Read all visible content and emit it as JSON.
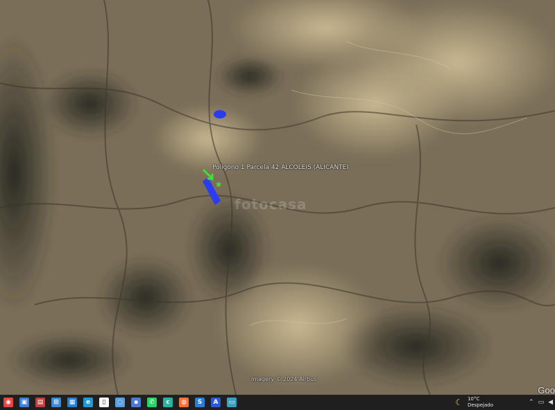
{
  "map": {
    "placemark_label": "Polígono 1 Parcela 42 ALCOLEIS (ALICANTE)",
    "watermark": "fotocasa",
    "imagery_credit": "Imagery © 2024 Airbus",
    "logo": "Goo"
  },
  "colors": {
    "parcel_fill": "#2b3cf0",
    "arrow": "#44dd33"
  },
  "taskbar": {
    "items": [
      {
        "name": "chrome-icon",
        "color": "#e8453c",
        "glyph": "◉"
      },
      {
        "name": "taskview-icon",
        "color": "#3b7fd9",
        "glyph": "▣"
      },
      {
        "name": "explorer-icon",
        "color": "#c04040",
        "glyph": "▤"
      },
      {
        "name": "network-icon",
        "color": "#3a8ad6",
        "glyph": "⊞"
      },
      {
        "name": "photos-icon",
        "color": "#2a7fd0",
        "glyph": "▦"
      },
      {
        "name": "edge-icon",
        "color": "#1e9ad6",
        "glyph": "e"
      },
      {
        "name": "document-icon",
        "color": "#ffffff",
        "glyph": "▯"
      },
      {
        "name": "browser-icon",
        "color": "#5aa0e0",
        "glyph": "◌"
      },
      {
        "name": "save-icon",
        "color": "#4a7bd0",
        "glyph": "▪"
      },
      {
        "name": "whatsapp-icon",
        "color": "#25d366",
        "glyph": "✆"
      },
      {
        "name": "teams-icon",
        "color": "#2bb3a0",
        "glyph": "c"
      },
      {
        "name": "firefox-icon",
        "color": "#ff7139",
        "glyph": "◍"
      },
      {
        "name": "skype-icon",
        "color": "#2a7dd6",
        "glyph": "S"
      },
      {
        "name": "acrobat-icon",
        "color": "#2a5ad6",
        "glyph": "A"
      },
      {
        "name": "monitor-icon",
        "color": "#3aa0c0",
        "glyph": "▭"
      }
    ],
    "weather_temp": "10°C",
    "weather_condition": "Despejado"
  }
}
